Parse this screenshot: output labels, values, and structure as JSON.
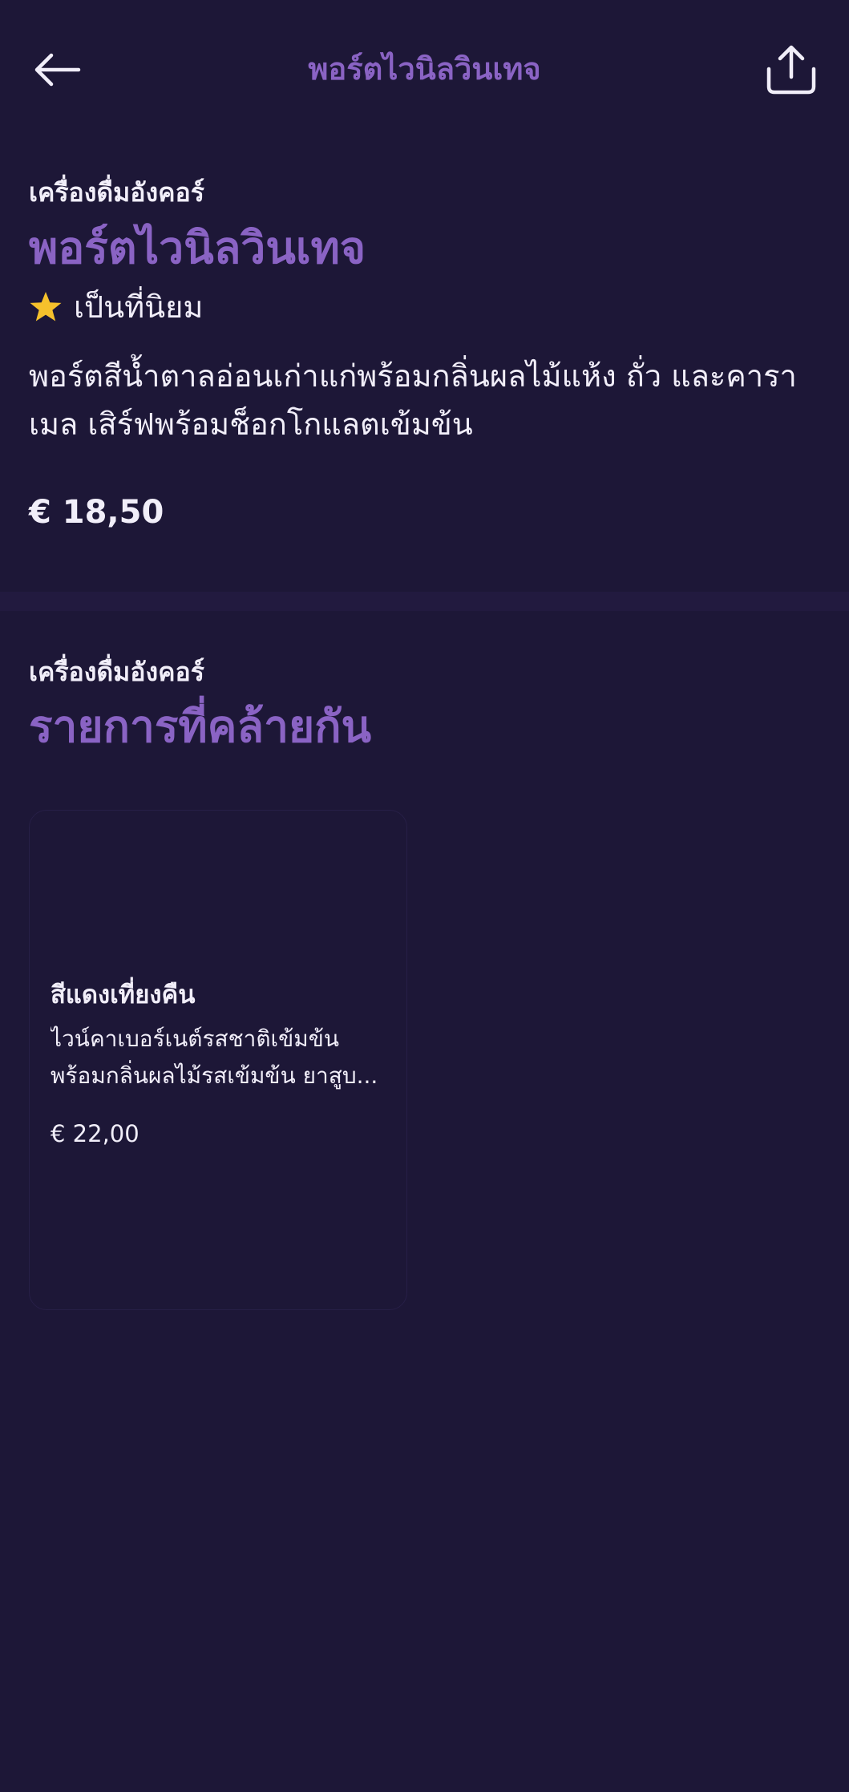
{
  "header": {
    "title": "พอร์ตไวนิลวินเทจ",
    "back_icon": "arrow-left-icon",
    "share_icon": "share-icon"
  },
  "product": {
    "category": "เครื่องดื่มอังคอร์",
    "name": "พอร์ตไวนิลวินเทจ",
    "badge_icon": "star-icon",
    "badge_label": "เป็นที่นิยม",
    "description_line1": "พอร์ตสีน้ำตาลอ่อนเก่าแก่พร้อมกลิ่นผลไม้แห้ง ถั่ว และคารา",
    "description_line2": "เมล เสิร์ฟพร้อมช็อกโกแลตเข้มข้น",
    "price": "€ 18,50"
  },
  "similar": {
    "category": "เครื่องดื่มอังคอร์",
    "title": "รายการที่คล้ายกัน",
    "items": [
      {
        "name": "สีแดงเที่ยงคืน",
        "description_line1": "ไวน์คาเบอร์เนต์รสชาติเข้มข้น",
        "description_line2": "พร้อมกลิ่นผลไม้รสเข้มข้น ยาสูบ...",
        "price": "€ 22,00"
      }
    ]
  },
  "colors": {
    "background": "#1d1737",
    "accent": "#8a63c4",
    "text": "#f1eef9",
    "star": "#f6c12c"
  }
}
